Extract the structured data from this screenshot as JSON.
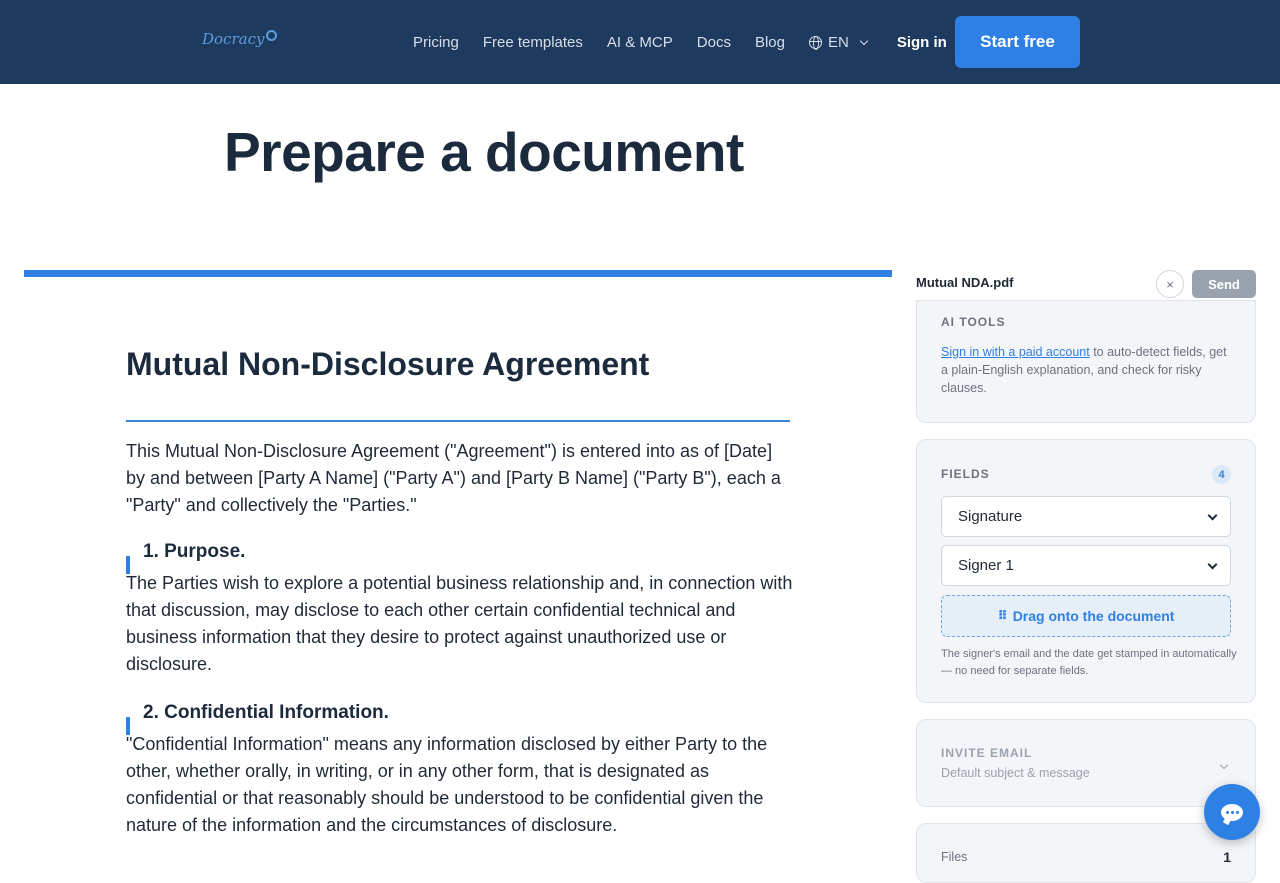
{
  "header": {
    "logo_text": "Docracy",
    "nav": [
      {
        "label": "Pricing"
      },
      {
        "label": "Free templates"
      },
      {
        "label": "AI & MCP"
      },
      {
        "label": "Docs"
      },
      {
        "label": "Blog"
      }
    ],
    "language": "EN",
    "signin_label": "Sign in",
    "start_label": "Start free"
  },
  "page": {
    "title": "Prepare a document"
  },
  "document": {
    "title": "Mutual Non-Disclosure Agreement",
    "intro": "This Mutual Non-Disclosure Agreement (\"Agreement\") is entered into as of [Date] by and between [Party A Name] (\"Party A\") and [Party B Name] (\"Party B\"), each a \"Party\" and collectively the \"Parties.\"",
    "sections": [
      {
        "heading": "1. Purpose.",
        "body": "The Parties wish to explore a potential business relationship and, in connection with that discussion, may disclose to each other certain confidential technical and business information that they desire to protect against unauthorized use or disclosure."
      },
      {
        "heading": "2. Confidential Information.",
        "body": "\"Confidential Information\" means any information disclosed by either Party to the other, whether orally, in writing, or in any other form, that is designated as confidential or that reasonably should be understood to be confidential given the nature of the information and the circumstances of disclosure."
      }
    ]
  },
  "sidebar": {
    "filename": "Mutual NDA.pdf",
    "close_label": "×",
    "send_label": "Send",
    "ai_tools": {
      "label": "AI TOOLS",
      "link_text": "Sign in with a paid account",
      "description": " to auto-detect fields, get a plain-English explanation, and check for risky clauses."
    },
    "fields": {
      "label": "FIELDS",
      "count": "4",
      "field_type": "Signature",
      "signer": "Signer 1",
      "drag_label": "Drag onto the document",
      "note": "The signer's email and the date get stamped in automatically — no need for separate fields."
    },
    "invite": {
      "label": "INVITE EMAIL",
      "subtitle": "Default subject & message"
    },
    "files": {
      "label": "Files",
      "count": "1"
    }
  },
  "icons": {
    "globe": "globe-icon",
    "chevron": "chevron-down-icon",
    "chat": "chat-bubble-icon",
    "grip": "drag-handle-icon"
  },
  "colors": {
    "header_bg": "#1e3a5f",
    "accent": "#2f80e4",
    "send_disabled": "#9aa3ad"
  }
}
